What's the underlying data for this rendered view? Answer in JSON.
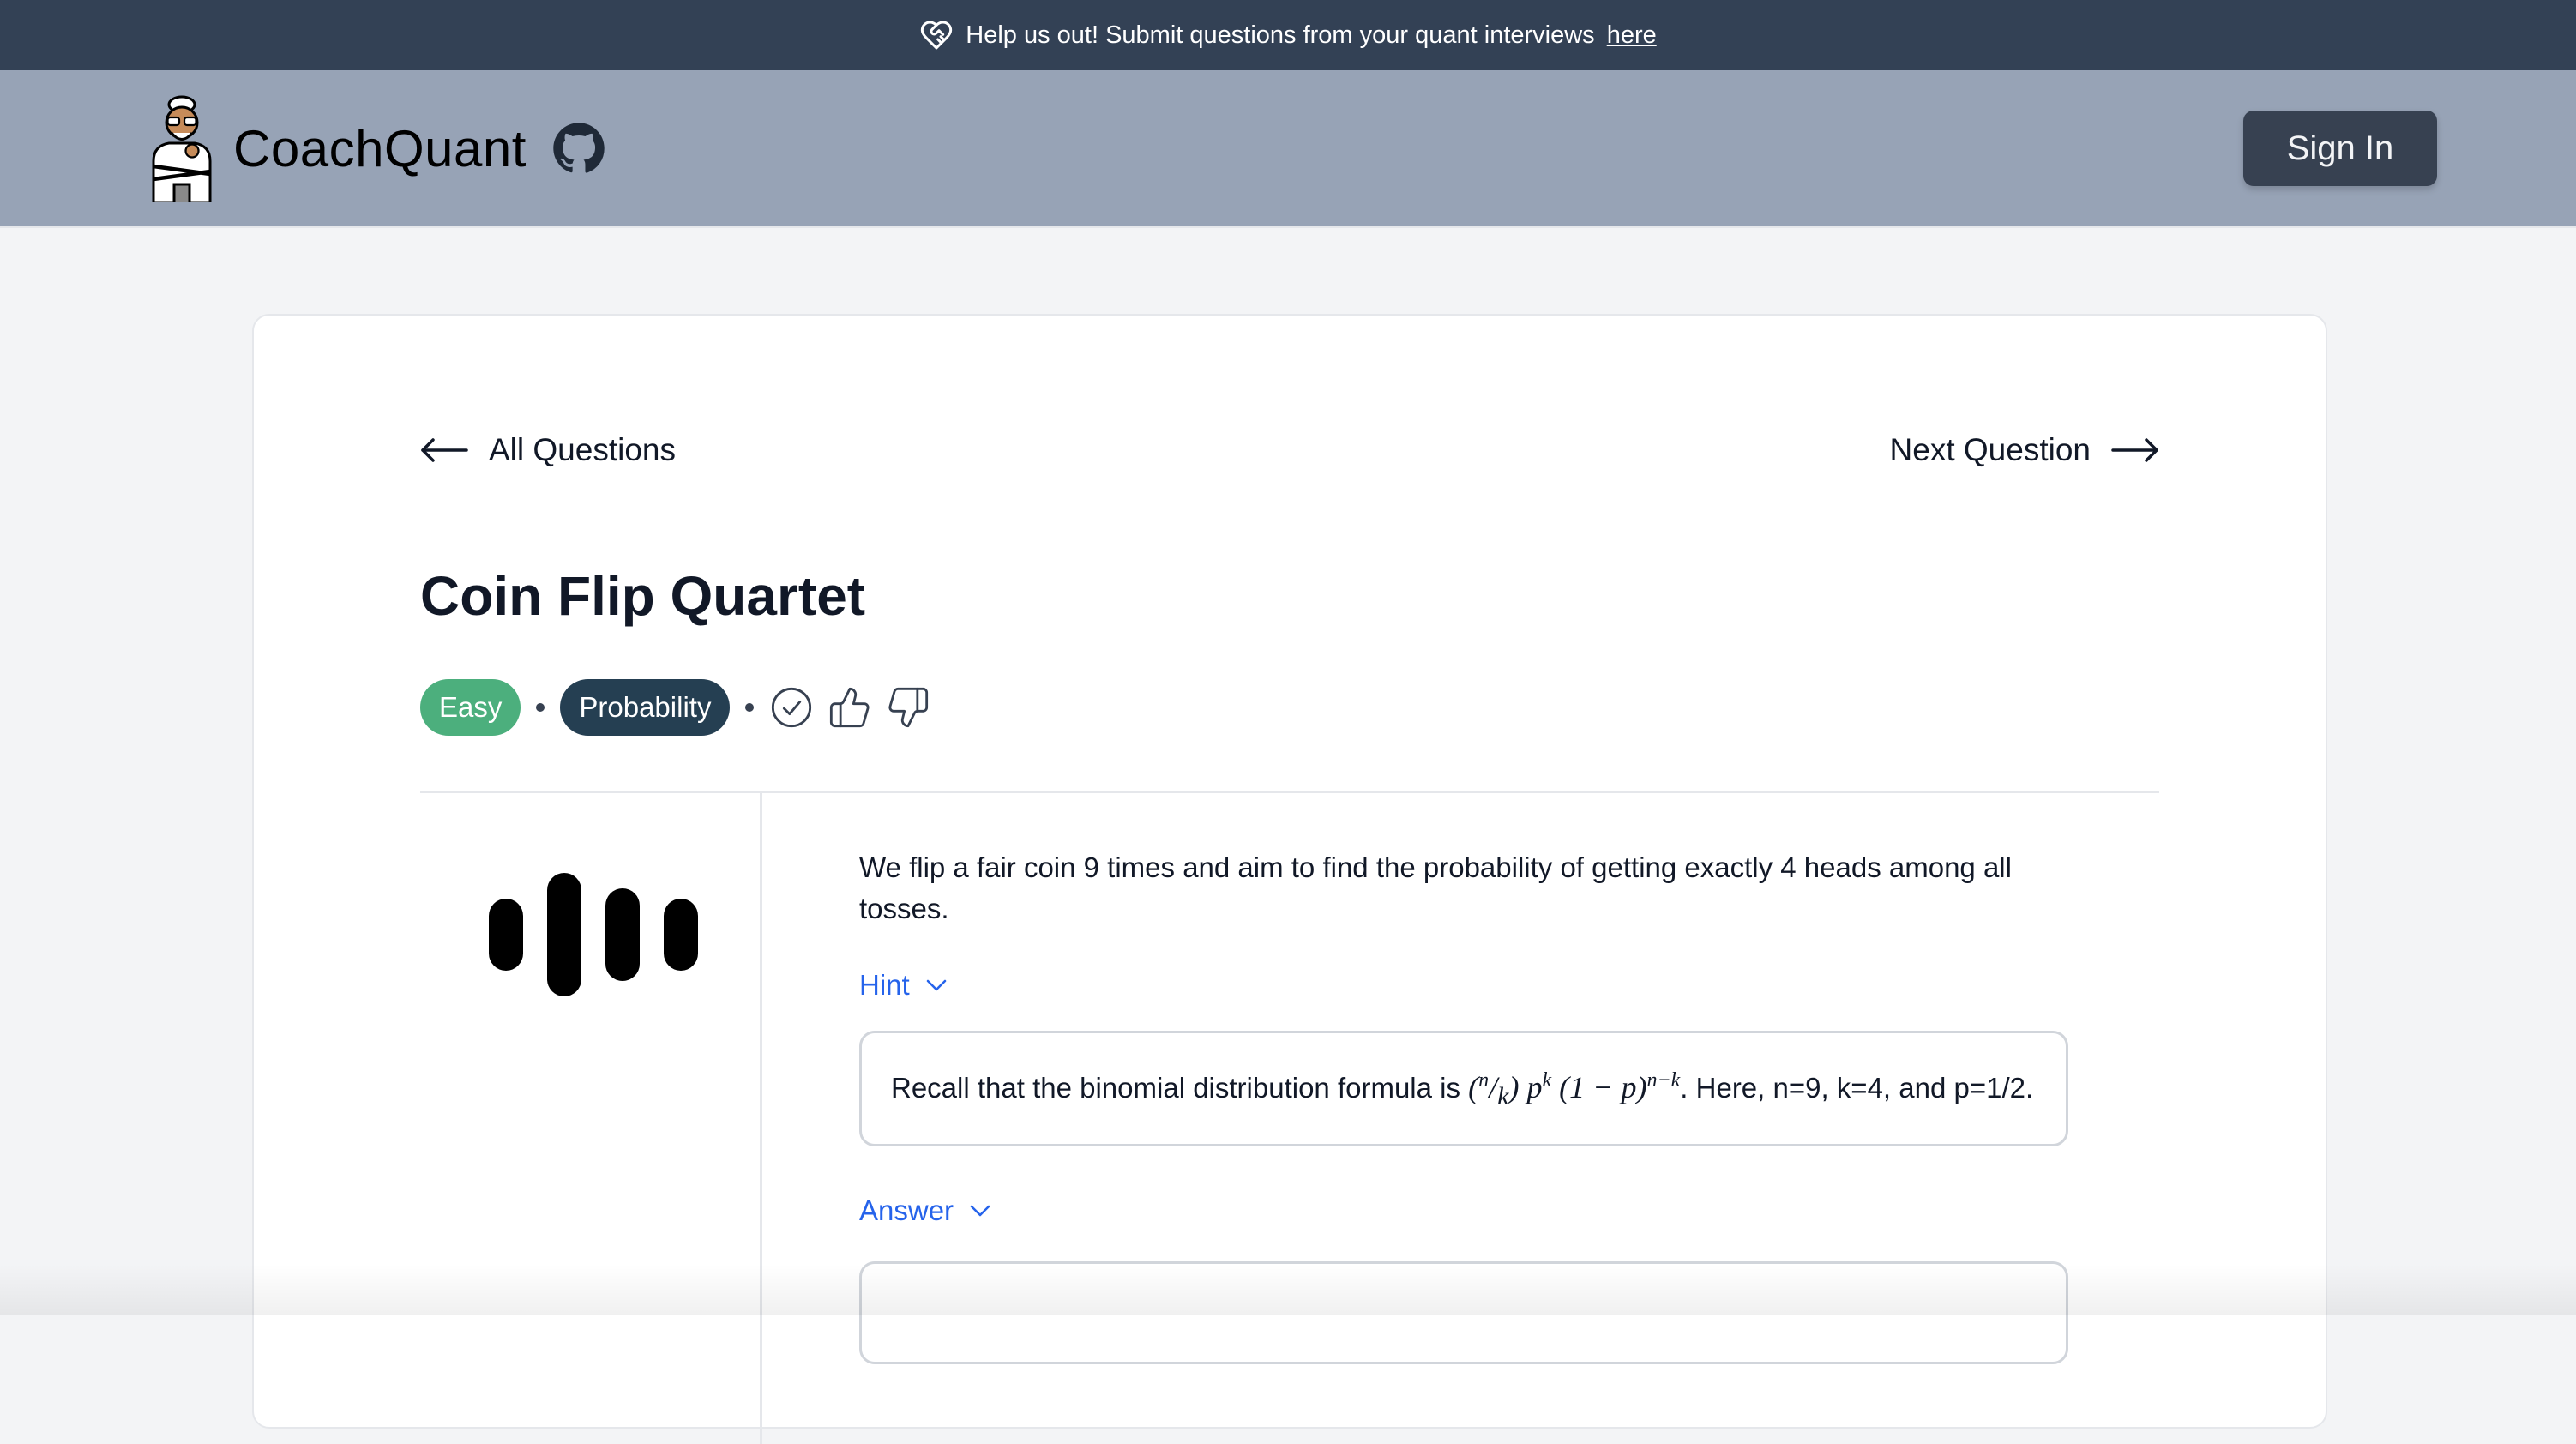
{
  "banner": {
    "text": "Help us out! Submit questions from your quant interviews",
    "link": "here"
  },
  "header": {
    "brand": "CoachQuant",
    "sign_in": "Sign In"
  },
  "nav": {
    "back": "All Questions",
    "next": "Next Question"
  },
  "question": {
    "title": "Coin Flip Quartet",
    "difficulty": "Easy",
    "topic": "Probability",
    "text": "We flip a fair coin 9 times and aim to find the probability of getting exactly 4 heads among all tosses.",
    "hint_label": "Hint",
    "hint_prefix": "Recall that the binomial distribution formula is",
    "hint_suffix": ". Here, n=9, k=4, and p=1/2.",
    "answer_label": "Answer"
  },
  "colors": {
    "banner_bg": "#334155",
    "header_bg": "#97a3b6",
    "easy": "#4caf7d",
    "topic": "#253f52",
    "link": "#2563eb"
  }
}
